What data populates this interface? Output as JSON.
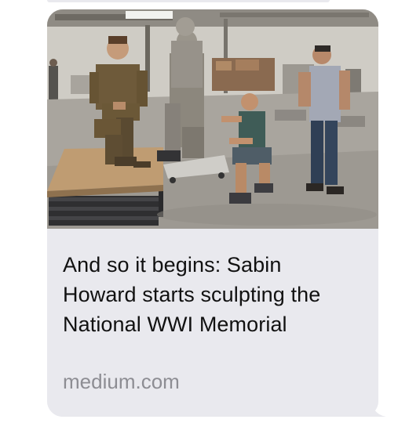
{
  "link_preview": {
    "title": "And so it begins: Sabin Howard starts sculpting the National WWI Memorial",
    "domain": "medium.com"
  },
  "colors": {
    "bubble_background": "#e9e9ee",
    "title_text": "#111111",
    "domain_text": "#8d8d93"
  },
  "photo": {
    "subject": "sculptor working on statue in studio"
  }
}
